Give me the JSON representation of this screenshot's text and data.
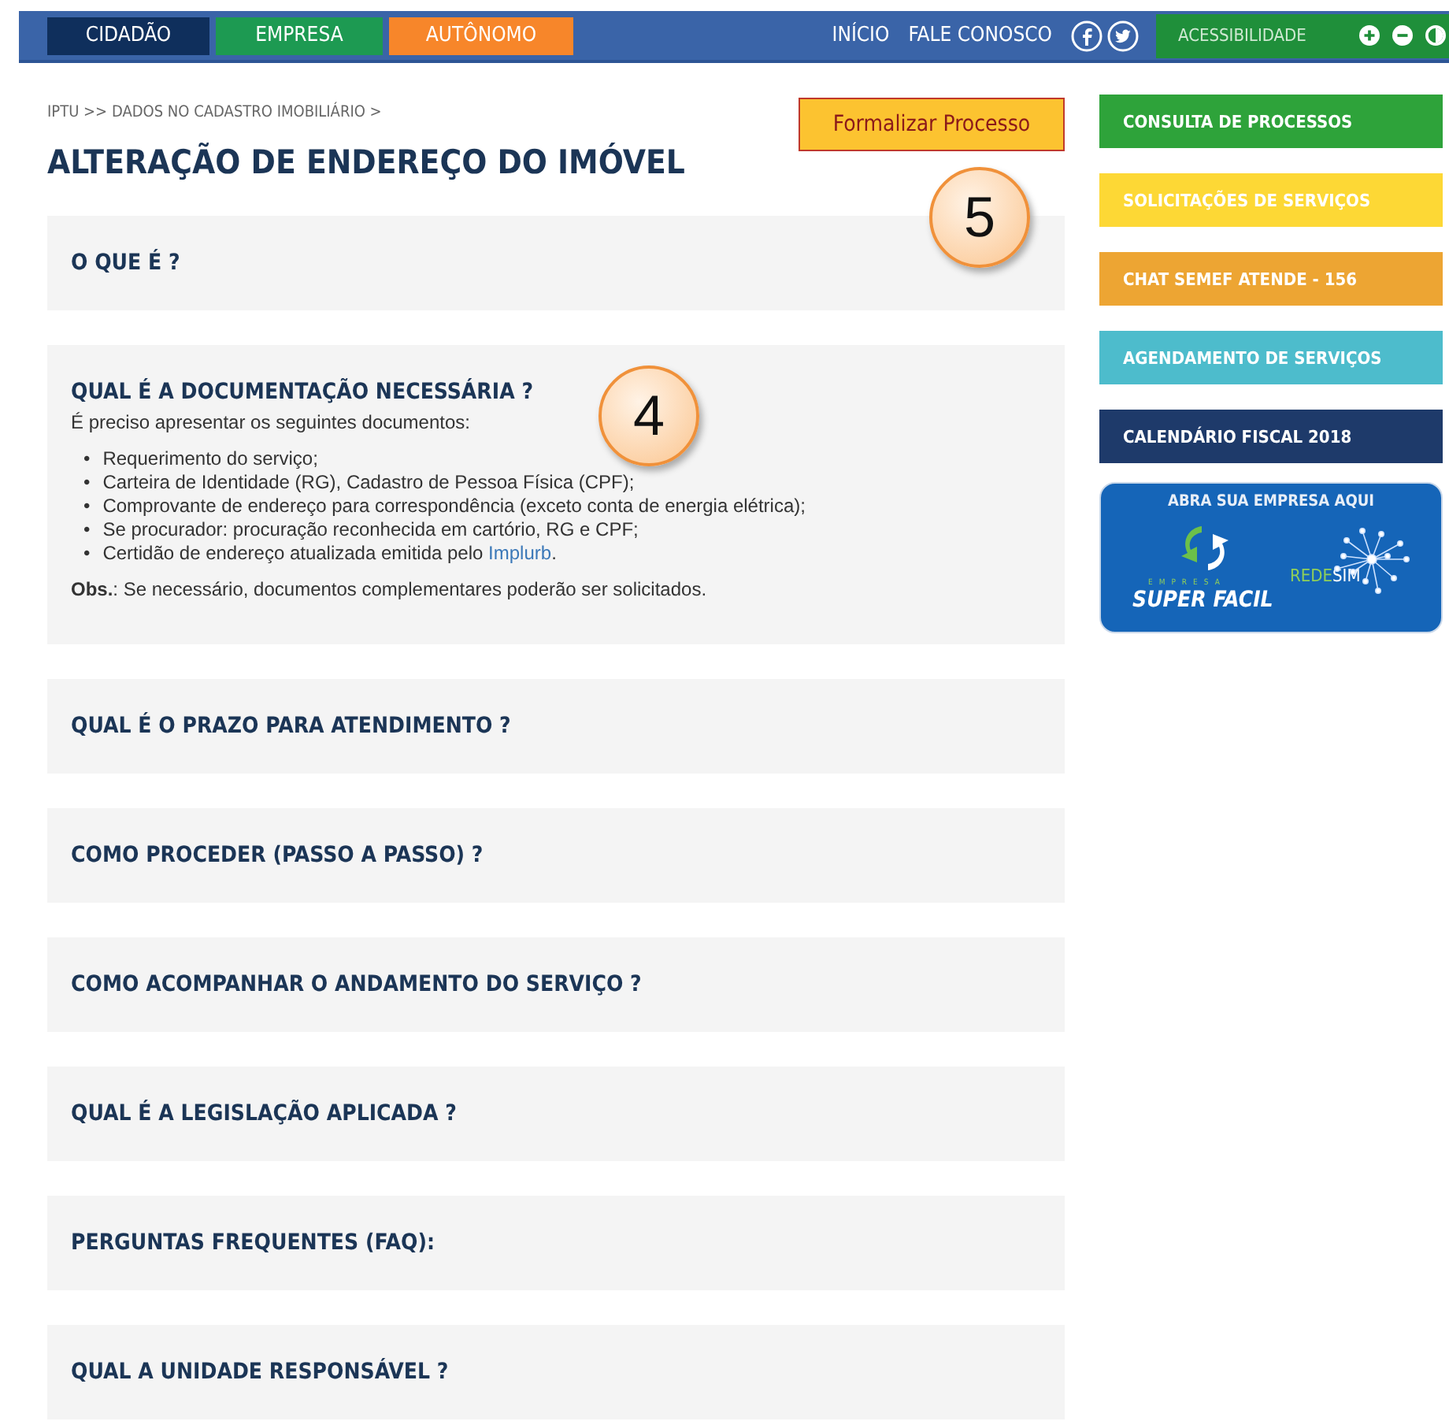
{
  "top_bar": {
    "audience_tabs": [
      {
        "label": "CIDADÃO",
        "color": "#0f2f5c"
      },
      {
        "label": "EMPRESA",
        "color": "#1d9a52"
      },
      {
        "label": "AUTÔNOMO",
        "color": "#f7862a"
      }
    ],
    "links": [
      "INÍCIO",
      "FALE CONOSCO"
    ],
    "accessibility": {
      "label": "ACESSIBILIDADE"
    }
  },
  "breadcrumb": "IPTU >> DADOS NO CADASTRO IMOBILIÁRIO >",
  "title": "ALTERAÇÃO DE ENDEREÇO DO IMÓVEL",
  "action_button": "Formalizar Processo",
  "callouts": [
    {
      "label": "5"
    },
    {
      "label": "4"
    }
  ],
  "sections": [
    {
      "heading": "O QUE É ?",
      "expanded": false
    },
    {
      "heading": "QUAL É A DOCUMENTAÇÃO NECESSÁRIA ?",
      "expanded": true,
      "bullet": "•",
      "intro": "É preciso apresentar os seguintes documentos:",
      "items": [
        "Requerimento do serviço;",
        "Carteira de Identidade (RG), Cadastro de Pessoa Física (CPF);",
        "Comprovante de endereço para correspondência (exceto conta de energia elétrica);",
        "Se procurador: procuração reconhecida em cartório, RG e CPF;"
      ],
      "last_item": {
        "text": "Certidão de endereço atualizada emitida pelo",
        "link": "Implurb",
        "end": "."
      },
      "note": "**Obs.**: Se necessário, documentos complementares poderão ser solicitados."
    },
    {
      "heading": "QUAL É O PRAZO PARA ATENDIMENTO ?",
      "expanded": false
    },
    {
      "heading": "COMO PROCEDER (PASSO A PASSO) ?",
      "expanded": false
    },
    {
      "heading": "COMO ACOMPANHAR O ANDAMENTO DO SERVIÇO ?",
      "expanded": false
    },
    {
      "heading": "QUAL É A LEGISLAÇÃO APLICADA ?",
      "expanded": false
    },
    {
      "heading": "PERGUNTAS FREQUENTES (FAQ):",
      "expanded": false
    },
    {
      "heading": "QUAL A UNIDADE RESPONSÁVEL ?",
      "expanded": false
    }
  ],
  "sidebar": {
    "buttons": [
      {
        "label": "CONSULTA DE PROCESSOS",
        "color": "#2ea33a"
      },
      {
        "label": "SOLICITAÇÕES DE SERVIÇOS",
        "color": "#fdd835"
      },
      {
        "label": "CHAT SEMEF ATENDE - 156",
        "color": "#eda533"
      },
      {
        "label": "AGENDAMENTO DE SERVIÇOS",
        "color": "#4dbccc"
      },
      {
        "label": "CALENDÁRIO FISCAL 2018",
        "color": "#1e3a6a"
      }
    ],
    "banner": {
      "title": "ABRA SUA EMPRESA AQUI",
      "small": "EMPRESA",
      "brand": "SUPER FACIL",
      "rede": "REDE",
      "sim": "SIM"
    }
  }
}
